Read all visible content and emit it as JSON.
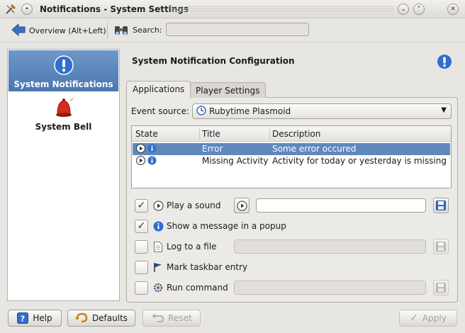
{
  "window": {
    "title": "Notifications - System Settings"
  },
  "toolbar": {
    "overview_label": "Overview (Alt+Left)",
    "search_label": "Search:",
    "search_value": ""
  },
  "sidebar": {
    "items": [
      {
        "label": "System Notifications",
        "icon": "info-icon",
        "active": true
      },
      {
        "label": "System Bell",
        "icon": "bell-icon",
        "active": false
      }
    ]
  },
  "main": {
    "heading": "System Notification Configuration",
    "tabs": [
      {
        "label": "Applications",
        "active": true
      },
      {
        "label": "Player Settings",
        "active": false
      }
    ],
    "event_source_label": "Event source:",
    "event_source_value": "Rubytime Plasmoid",
    "table": {
      "columns": [
        "State",
        "Title",
        "Description"
      ],
      "rows": [
        {
          "title": "Error",
          "description": "Some error occured",
          "selected": true
        },
        {
          "title": "Missing Activity",
          "description": "Activity for today or yesterday is missing",
          "selected": false
        }
      ]
    },
    "options": {
      "play_sound": {
        "label": "Play a sound",
        "checked": true,
        "value": ""
      },
      "show_popup": {
        "label": "Show a message in a popup",
        "checked": true
      },
      "log_file": {
        "label": "Log to a file",
        "checked": false,
        "value": ""
      },
      "mark_taskbar": {
        "label": "Mark taskbar entry",
        "checked": false
      },
      "run_command": {
        "label": "Run command",
        "checked": false,
        "value": ""
      }
    }
  },
  "footer": {
    "help_label": "Help",
    "defaults_label": "Defaults",
    "reset_label": "Reset",
    "apply_label": "Apply"
  },
  "colors": {
    "selection": "#5f88bd",
    "info_blue": "#2f6fcf",
    "bell_red": "#d42a20"
  }
}
